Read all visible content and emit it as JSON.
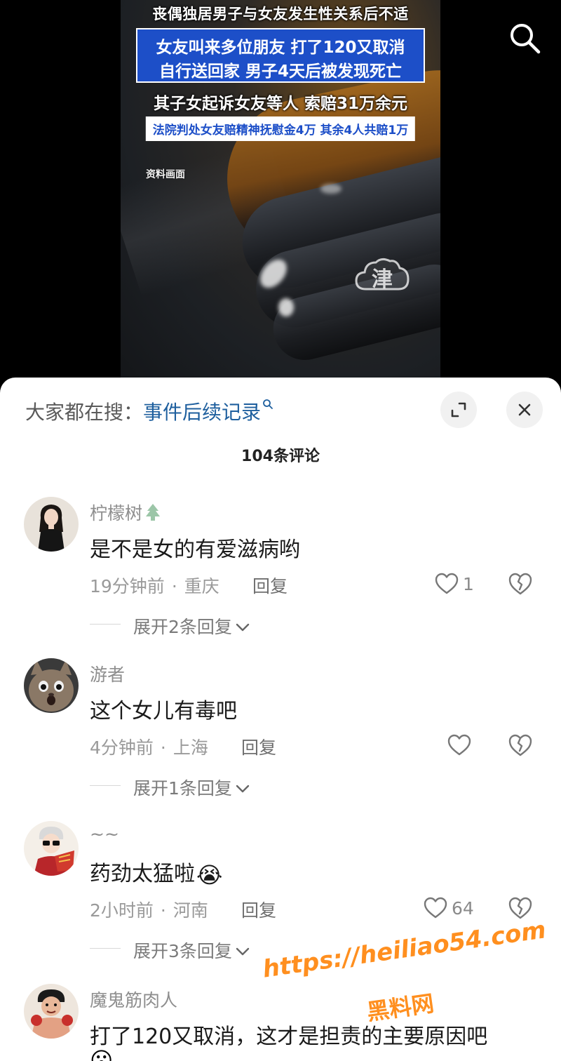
{
  "video": {
    "caption_line1": "丧偶独居男子与女友发生性关系后不适",
    "caption_line2": "女友叫来多位朋友 打了120又取消",
    "caption_line3": "自行送回家 男子4天后被发现死亡",
    "caption_line4": "其子女起诉女友等人 索赔31万余元",
    "caption_line5": "法院判处女友赔精神抚慰金4万 其余4人共赔1万",
    "archive_label": "资料画面",
    "logo_glyph": "津",
    "search_icon": "search-icon"
  },
  "sheet": {
    "search_prefix": "大家都在搜：",
    "search_keyword": "事件后续记录",
    "expand_icon": "expand-icon",
    "close_icon": "close-icon",
    "comment_count": "104条评论"
  },
  "comments": [
    {
      "username": "柠檬树",
      "username_badge": "tree-icon",
      "text": "是不是女的有爱滋病哟",
      "time": "19分钟前",
      "location": "重庆",
      "reply_label": "回复",
      "likes": "1",
      "expand_label": "展开2条回复"
    },
    {
      "username": "游者",
      "text": "这个女儿有毒吧",
      "time": "4分钟前",
      "location": "上海",
      "reply_label": "回复",
      "likes": "",
      "expand_label": "展开1条回复"
    },
    {
      "username": "~~",
      "text": "药劲太猛啦",
      "text_emoji": "😭",
      "time": "2小时前",
      "location": "河南",
      "reply_label": "回复",
      "likes": "64",
      "expand_label": "展开3条回复"
    },
    {
      "username": "魔鬼筋肉人",
      "text": "打了120又取消，这才是担责的主要原因吧",
      "text_emoji": "😮"
    }
  ],
  "watermark": {
    "url": "https://heiliao54.com",
    "site": "黑料网"
  },
  "colors": {
    "caption_blue": "#1d4fc8",
    "keyword_blue": "#1e5f9e",
    "watermark_orange": "#ff8f1f"
  }
}
